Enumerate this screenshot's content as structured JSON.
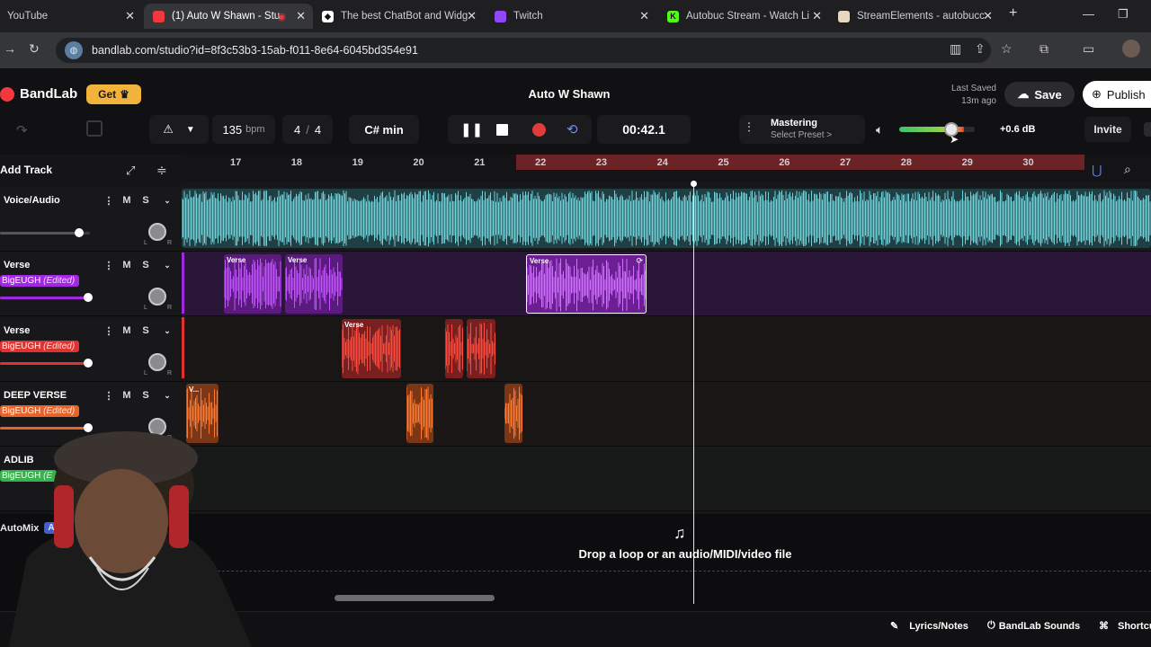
{
  "browser": {
    "tabs": [
      {
        "title": "YouTube",
        "favicon_color": "#ff0000"
      },
      {
        "title": "(1) Auto W Shawn - Stu",
        "favicon_color": "#f2373e",
        "active": true
      },
      {
        "title": "The best ChatBot and Widg",
        "favicon_color": "#3b3b3f"
      },
      {
        "title": "Twitch",
        "favicon_color": "#9146ff"
      },
      {
        "title": "Autobuc Stream - Watch Li",
        "favicon_color": "#53fc18"
      },
      {
        "title": "StreamElements - autobucc",
        "favicon_color": "#e7d8c4"
      }
    ],
    "url": "bandlab.com/studio?id=8f3c53b3-15ab-f011-8e64-6045bd354e91"
  },
  "header": {
    "brand": "BandLab",
    "get_label": "Get",
    "song_title": "Auto W Shawn",
    "last_saved_label": "Last Saved",
    "last_saved_time": "13m ago",
    "save_label": "Save",
    "publish_label": "Publish",
    "invite_label": "Invite"
  },
  "transport": {
    "bpm": "135",
    "bpm_unit": "bpm",
    "time_sig_num": "4",
    "time_sig_den": "4",
    "key": "C# min",
    "time": "00:42.1",
    "mastering_label": "Mastering",
    "mastering_preset": "Select Preset >",
    "master_gain": "+0.6 dB",
    "master_volume_level": 0.69
  },
  "sidebar": {
    "add_track_label": "Add Track",
    "automix_label": "AutoMix",
    "ai_badge": "AI"
  },
  "tracks": [
    {
      "name": "Voice/Audio",
      "tag": "",
      "color": "#6fd3da",
      "fader_level": 0.88
    },
    {
      "name": "Verse",
      "tag": "BigEUGH",
      "tag_suffix": "(Edited)",
      "color": "#a227e2",
      "fader_level": 0.98
    },
    {
      "name": "Verse",
      "tag": "BigEUGH",
      "tag_suffix": "(Edited)",
      "color": "#e0332f",
      "fader_level": 0.98
    },
    {
      "name": "DEEP VERSE",
      "tag": "BigEUGH",
      "tag_suffix": "(Edited)",
      "color": "#e8632a",
      "fader_level": 0.98
    },
    {
      "name": "ADLIB",
      "tag": "BigEUGH",
      "tag_suffix": "(E",
      "color": "#37b24d",
      "fader_level": 0.98
    }
  ],
  "ruler": {
    "bars": [
      "17",
      "18",
      "19",
      "20",
      "21",
      "22",
      "23",
      "24",
      "25",
      "26",
      "27",
      "28",
      "29",
      "30"
    ]
  },
  "clips": {
    "verse_label": "Verse",
    "short_label": "V..."
  },
  "dropzone": {
    "text": "Drop a loop or an audio/MIDI/video file"
  },
  "bottom": {
    "lyrics_label": "Lyrics/Notes",
    "sounds_label": "BandLab Sounds",
    "shortcuts_label": "Shortcuts"
  },
  "colors": {
    "accent": "#f2373e",
    "loop_region": "#6b2326"
  }
}
